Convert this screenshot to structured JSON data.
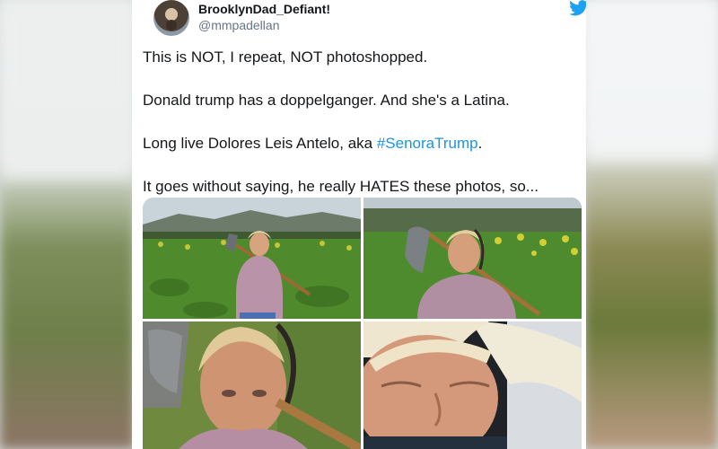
{
  "tweet": {
    "display_name": "BrooklynDad_Defiant!",
    "handle": "@mmpadellan",
    "paragraphs": [
      {
        "text": "This is NOT, I repeat, NOT photoshopped."
      },
      {
        "text": "Donald trump has a doppelganger. And she's a Latina."
      },
      {
        "text_before": "Long live Dolores Leis Antelo, aka ",
        "hashtag": "#SenoraTrump",
        "text_after": "."
      },
      {
        "text": "It goes without saying, he really HATES these photos, so..."
      }
    ],
    "media": [
      {
        "icon": "photo"
      },
      {
        "icon": "photo"
      },
      {
        "icon": "photo"
      },
      {
        "icon": "photo"
      }
    ]
  },
  "icons": {
    "brand": "twitter-bird-icon"
  },
  "colors": {
    "brand_blue": "#1da1f2",
    "hashtag": "#1b95e0",
    "text": "#14171a",
    "secondary_text": "#657786"
  }
}
